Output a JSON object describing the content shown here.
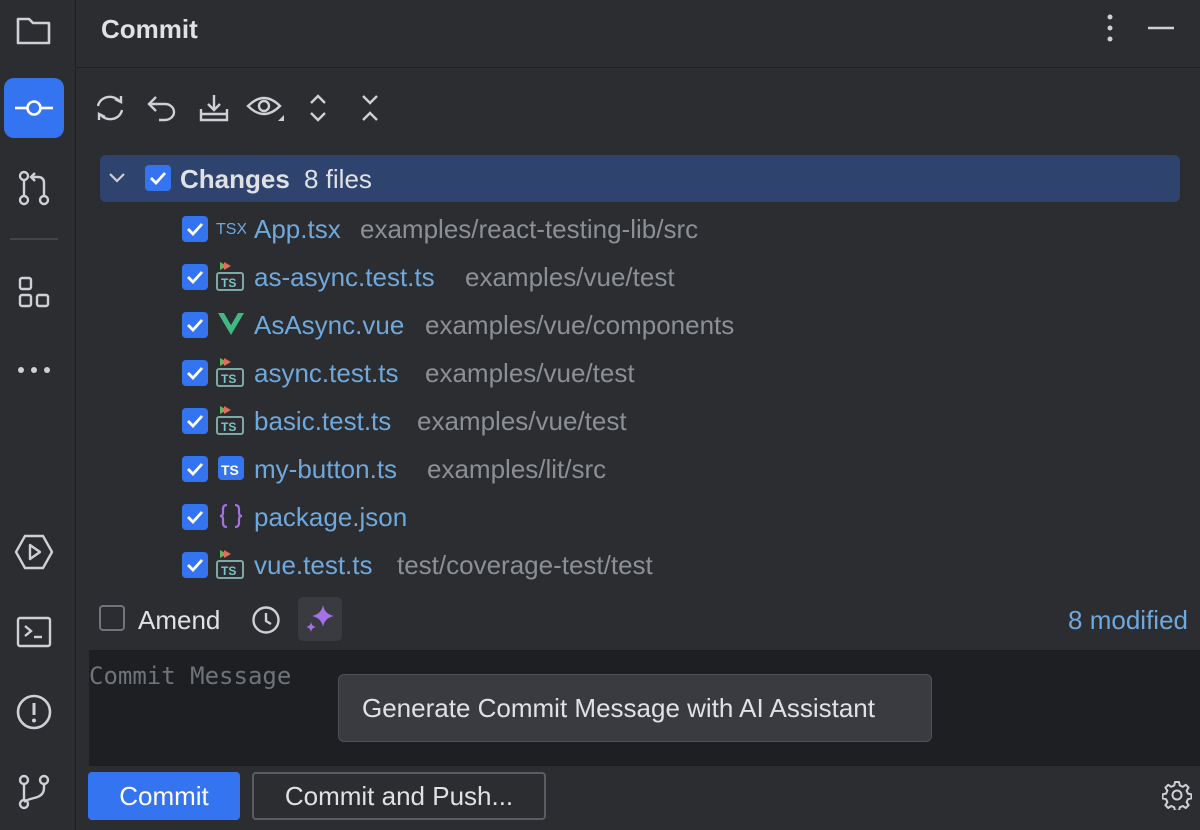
{
  "window": {
    "title": "Commit"
  },
  "toolbar": {
    "items": [
      "refresh-icon",
      "rollback-icon",
      "shelve-icon",
      "eye-icon",
      "expand-all-icon",
      "collapse-all-icon"
    ]
  },
  "changes": {
    "label": "Changes",
    "count": "8 files",
    "files": [
      {
        "name": "App.tsx",
        "path": "examples/react-testing-lib/src",
        "icon": "tsx-icon"
      },
      {
        "name": "as-async.test.ts",
        "path": "examples/vue/test",
        "icon": "ts-test-icon"
      },
      {
        "name": "AsAsync.vue",
        "path": "examples/vue/components",
        "icon": "vue-icon"
      },
      {
        "name": "async.test.ts",
        "path": "examples/vue/test",
        "icon": "ts-test-icon"
      },
      {
        "name": "basic.test.ts",
        "path": "examples/vue/test",
        "icon": "ts-test-icon"
      },
      {
        "name": "my-button.ts",
        "path": "examples/lit/src",
        "icon": "ts-icon"
      },
      {
        "name": "package.json",
        "path": "",
        "icon": "json-icon"
      },
      {
        "name": "vue.test.ts",
        "path": "test/coverage-test/test",
        "icon": "ts-test-icon"
      }
    ]
  },
  "amend": {
    "label": "Amend",
    "checked": false
  },
  "status": {
    "modified": "8 modified"
  },
  "message": {
    "placeholder": "Commit Message"
  },
  "tooltip": {
    "text": "Generate Commit Message with AI Assistant"
  },
  "buttons": {
    "commit": "Commit",
    "commit_push": "Commit and Push..."
  },
  "colors": {
    "accent": "#3574f0",
    "link": "#6fa8dc",
    "selection": "#2e436e",
    "ai": "#a571e6"
  }
}
